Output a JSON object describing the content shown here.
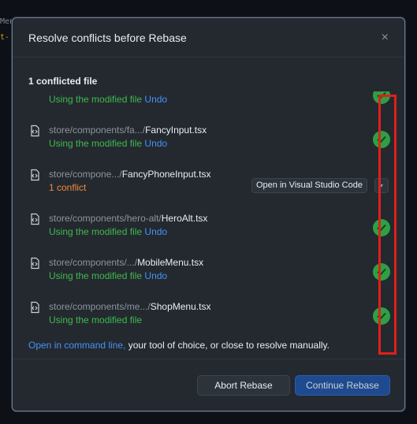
{
  "background": {
    "line1": "Men",
    "line2": "t-"
  },
  "dialog": {
    "title": "Resolve conflicts before Rebase",
    "close_icon": "×",
    "section_title": "1 conflicted file",
    "files": [
      {
        "dir": "",
        "name": "",
        "status": "Using the modified file",
        "undo": "Undo",
        "state": "resolved"
      },
      {
        "dir": "store/components/fa.../",
        "name": "FancyInput.tsx",
        "status": "Using the modified file",
        "undo": "Undo",
        "state": "resolved"
      },
      {
        "dir": "store/compone.../",
        "name": "FancyPhoneInput.tsx",
        "status": "1 conflict",
        "undo": "",
        "state": "conflict",
        "action": "Open in Visual Studio Code"
      },
      {
        "dir": "store/components/hero-alt/",
        "name": "HeroAlt.tsx",
        "status": "Using the modified file",
        "undo": "Undo",
        "state": "resolved"
      },
      {
        "dir": "store/components/.../",
        "name": "MobileMenu.tsx",
        "status": "Using the modified file",
        "undo": "Undo",
        "state": "resolved"
      },
      {
        "dir": "store/components/me.../",
        "name": "ShopMenu.tsx",
        "status": "Using the modified file",
        "undo": "",
        "state": "resolved"
      }
    ],
    "footer_link": "Open in command line,",
    "footer_rest": " your tool of choice, or close to resolve manually.",
    "abort_label": "Abort Rebase",
    "continue_label": "Continue Rebase"
  },
  "colors": {
    "resolved": "#3fb950",
    "conflict": "#f0883e",
    "link": "#4493f8",
    "highlight": "#e0201a"
  }
}
